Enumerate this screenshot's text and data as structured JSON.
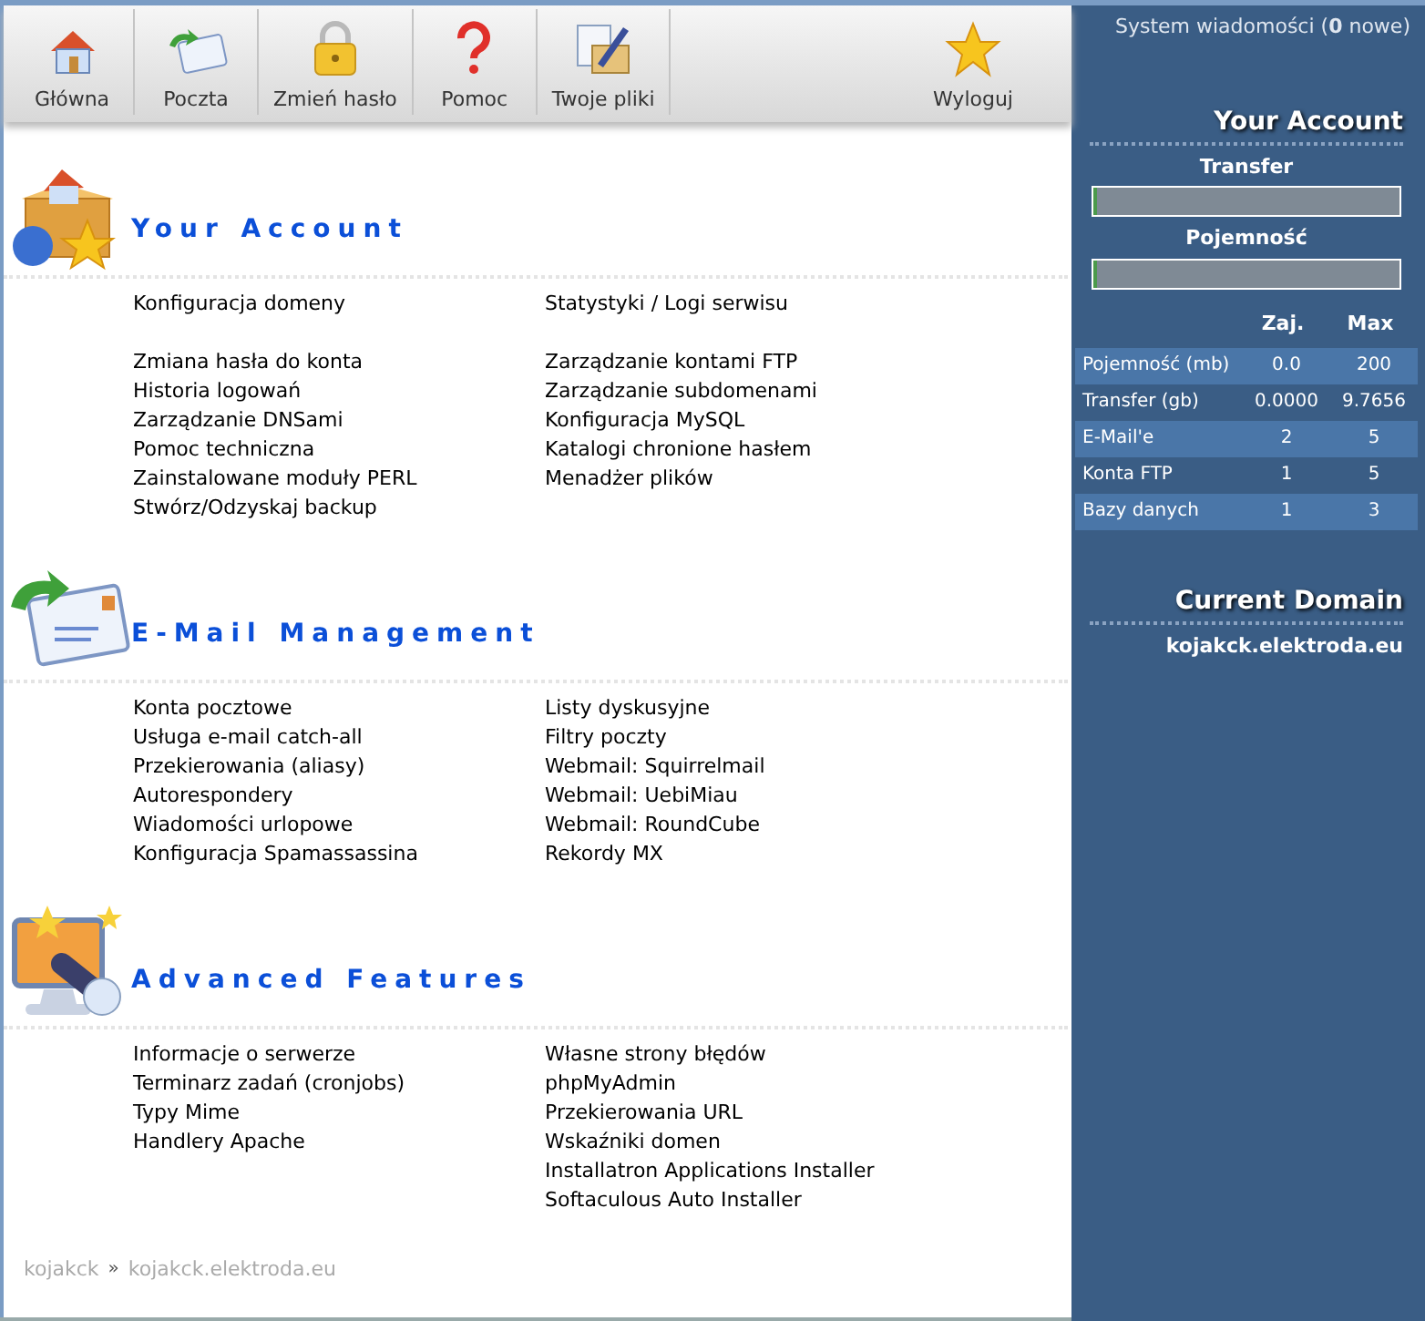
{
  "toolbar": [
    {
      "label": "Główna",
      "kind": "house"
    },
    {
      "label": "Poczta",
      "kind": "mail"
    },
    {
      "label": "Zmień hasło",
      "kind": "lock"
    },
    {
      "label": "Pomoc",
      "kind": "help"
    },
    {
      "label": "Twoje pliki",
      "kind": "files"
    },
    {
      "label": "Wyloguj",
      "kind": "star"
    }
  ],
  "sections": [
    {
      "title": "Your Account",
      "kind": "account",
      "groups": [
        [
          {
            "left": "Konfiguracja domeny",
            "right": "Statystyki / Logi serwisu"
          }
        ],
        [
          {
            "left": "Zmiana hasła do konta",
            "right": "Zarządzanie kontami FTP"
          },
          {
            "left": "Historia logowań",
            "right": "Zarządzanie subdomenami"
          },
          {
            "left": "Zarządzanie DNSami",
            "right": "Konfiguracja MySQL"
          },
          {
            "left": "Pomoc techniczna",
            "right": "Katalogi chronione hasłem"
          },
          {
            "left": "Zainstalowane moduły PERL",
            "right": "Menadżer plików"
          },
          {
            "left": "Stwórz/Odzyskaj backup"
          }
        ]
      ]
    },
    {
      "title": "E-Mail Management",
      "kind": "mail",
      "groups": [
        [
          {
            "left": "Konta pocztowe",
            "right": "Listy dyskusyjne"
          },
          {
            "left": "Usługa e-mail catch-all",
            "right": "Filtry poczty"
          },
          {
            "left": "Przekierowania (aliasy)",
            "right": "Webmail: Squirrelmail"
          },
          {
            "left": "Autorespondery",
            "right": "Webmail: UebiMiau"
          },
          {
            "left": "Wiadomości urlopowe",
            "right": "Webmail: RoundCube"
          },
          {
            "left": "Konfiguracja Spamassassina",
            "right": "Rekordy MX"
          }
        ]
      ]
    },
    {
      "title": "Advanced Features",
      "kind": "advanced",
      "groups": [
        [
          {
            "left": "Informacje o serwerze",
            "right": "Własne strony błędów"
          },
          {
            "left": "Terminarz zadań (cronjobs)",
            "right": "phpMyAdmin"
          },
          {
            "left": "Typy Mime",
            "right": "Przekierowania URL"
          },
          {
            "left": "Handlery Apache",
            "right": "Wskaźniki domen"
          },
          {
            "right": "Installatron Applications Installer"
          },
          {
            "right": "Softaculous Auto Installer"
          }
        ]
      ]
    }
  ],
  "breadcrumb": {
    "user": "kojakck",
    "separator": "»",
    "domain": "kojakck.elektroda.eu"
  },
  "sidebar": {
    "messages": "System wiadomości (**0** nowe)",
    "account_title": "Your Account",
    "meters": [
      {
        "label": "Transfer",
        "level": 0.01
      },
      {
        "label": "Pojemność",
        "level": 0.01
      }
    ],
    "stats": {
      "columns": [
        "Zaj.",
        "Max"
      ],
      "rows": [
        {
          "name": "Pojemność (mb)",
          "used": "0.0",
          "max": "200"
        },
        {
          "name": "Transfer (gb)",
          "used": "0.0000",
          "max": "9.7656"
        },
        {
          "name": "E-Mail'e",
          "used": "2",
          "max": "5"
        },
        {
          "name": "Konta FTP",
          "used": "1",
          "max": "5"
        },
        {
          "name": "Bazy danych",
          "used": "1",
          "max": "3"
        }
      ]
    },
    "domain_title": "Current Domain",
    "domain": "kojakck.elektroda.eu"
  }
}
